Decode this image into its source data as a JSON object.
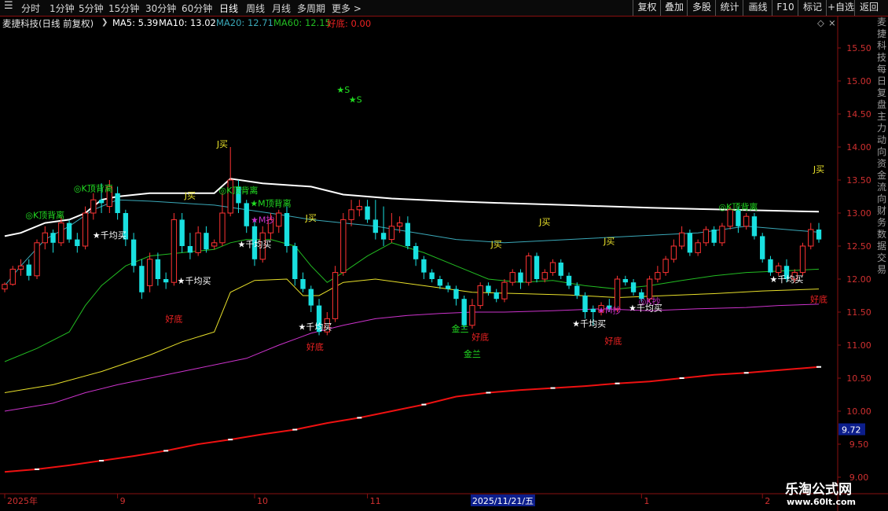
{
  "topbar": {
    "periods": [
      "分时",
      "1分钟",
      "5分钟",
      "15分钟",
      "30分钟",
      "60分钟",
      "日线",
      "周线",
      "月线",
      "多周期",
      "更多 >"
    ],
    "active_period": "日线",
    "buttons": [
      "复权",
      "叠加",
      "多股",
      "统计",
      "画线",
      "F10",
      "标记",
      "+自选",
      "返回"
    ]
  },
  "infobar": {
    "stock": "麦捷科技(日线 前复权)",
    "ma5": "MA5: 5.39",
    "ma10": "MA10: 13.02",
    "ma20": "MA20: 12.71",
    "ma60": "MA60: 12.15",
    "haodi": "好底: 0.00"
  },
  "colors": {
    "up": "#ff3333",
    "down": "#19e0e0",
    "ma10": "#ffffff",
    "ma20": "#3aa8b8",
    "ma60": "#22bb22",
    "ma_yellow": "#e8e02a",
    "ma_magenta": "#cc33cc",
    "long_line": "#ee1111",
    "axis": "#8a1010",
    "green_label": "#22dd22",
    "red_label": "#ee2222",
    "yellow_label": "#e8e02a",
    "white_label": "#ffffff"
  },
  "axis": {
    "y_ticks": [
      "15.50",
      "15.00",
      "14.50",
      "14.00",
      "13.50",
      "13.00",
      "12.50",
      "12.00",
      "11.50",
      "11.00",
      "10.50",
      "10.00",
      "9.50",
      "9.00"
    ],
    "price_tag": "9.72",
    "x_labels": [
      {
        "text": "2025年",
        "day": 0
      },
      {
        "text": "9",
        "day": 14
      },
      {
        "text": "10",
        "day": 31
      },
      {
        "text": "11",
        "day": 45
      },
      {
        "text": "2025/11/21/五",
        "day": 58
      },
      {
        "text": "1",
        "day": 79
      },
      {
        "text": "2",
        "day": 94
      }
    ]
  },
  "side_text": "麦捷科技每日复盘主力动向资金流向财务数据交易",
  "chart_data": {
    "type": "candlestick",
    "y_range": [
      8.75,
      15.75
    ],
    "days": 102,
    "candles": [
      [
        11.85,
        11.92,
        11.8,
        11.95
      ],
      [
        11.92,
        12.15,
        11.9,
        12.2
      ],
      [
        12.15,
        12.2,
        12.05,
        12.3
      ],
      [
        12.22,
        12.05,
        11.98,
        12.3
      ],
      [
        12.05,
        12.55,
        12.0,
        12.6
      ],
      [
        12.55,
        12.7,
        12.45,
        12.8
      ],
      [
        12.7,
        12.55,
        12.4,
        12.75
      ],
      [
        12.55,
        12.85,
        12.5,
        12.95
      ],
      [
        12.85,
        12.6,
        12.55,
        12.9
      ],
      [
        12.6,
        12.5,
        12.4,
        12.7
      ],
      [
        12.5,
        13.0,
        12.45,
        13.1
      ],
      [
        13.0,
        13.2,
        12.9,
        13.3
      ],
      [
        13.2,
        13.15,
        13.0,
        13.45
      ],
      [
        13.1,
        13.4,
        13.0,
        13.5
      ],
      [
        13.3,
        13.0,
        12.9,
        13.4
      ],
      [
        13.0,
        12.6,
        12.5,
        13.05
      ],
      [
        12.6,
        12.2,
        12.1,
        12.7
      ],
      [
        12.2,
        11.8,
        11.7,
        12.3
      ],
      [
        11.9,
        12.3,
        11.8,
        12.4
      ],
      [
        12.3,
        12.0,
        11.9,
        12.4
      ],
      [
        12.0,
        11.95,
        11.85,
        12.1
      ],
      [
        11.95,
        12.9,
        11.9,
        13.0
      ],
      [
        12.9,
        12.5,
        12.4,
        13.0
      ],
      [
        12.5,
        12.4,
        12.3,
        12.7
      ],
      [
        12.4,
        12.7,
        12.35,
        12.8
      ],
      [
        12.7,
        12.45,
        12.4,
        12.8
      ],
      [
        12.5,
        12.55,
        12.45,
        12.6
      ],
      [
        12.55,
        13.0,
        12.5,
        13.3
      ],
      [
        13.0,
        13.5,
        12.95,
        14.0
      ],
      [
        13.4,
        13.15,
        13.0,
        13.5
      ],
      [
        13.15,
        12.8,
        12.7,
        13.2
      ],
      [
        12.8,
        12.3,
        12.2,
        12.9
      ],
      [
        12.3,
        12.7,
        12.25,
        12.8
      ],
      [
        12.7,
        12.9,
        12.6,
        13.0
      ],
      [
        12.8,
        13.0,
        12.7,
        13.05
      ],
      [
        13.0,
        12.5,
        12.4,
        13.1
      ],
      [
        12.5,
        12.0,
        11.9,
        12.55
      ],
      [
        12.0,
        11.85,
        11.8,
        12.1
      ],
      [
        11.85,
        11.6,
        11.5,
        11.9
      ],
      [
        11.6,
        11.2,
        11.15,
        11.7
      ],
      [
        11.2,
        11.4,
        11.15,
        11.5
      ],
      [
        11.4,
        12.1,
        11.35,
        12.2
      ],
      [
        12.1,
        12.9,
        12.05,
        13.0
      ],
      [
        12.9,
        13.05,
        12.8,
        13.2
      ],
      [
        13.05,
        13.1,
        12.95,
        13.2
      ],
      [
        13.1,
        12.9,
        12.85,
        13.2
      ],
      [
        12.9,
        12.7,
        12.6,
        13.2
      ],
      [
        12.7,
        12.6,
        12.5,
        13.1
      ],
      [
        12.6,
        12.8,
        12.55,
        13.0
      ],
      [
        12.8,
        12.85,
        12.7,
        12.95
      ],
      [
        12.85,
        12.5,
        12.45,
        12.95
      ],
      [
        12.5,
        12.3,
        12.2,
        12.55
      ],
      [
        12.3,
        12.1,
        12.0,
        12.35
      ],
      [
        12.1,
        12.0,
        11.95,
        12.15
      ],
      [
        12.0,
        11.9,
        11.85,
        12.05
      ],
      [
        11.9,
        11.85,
        11.8,
        11.95
      ],
      [
        11.85,
        11.7,
        11.6,
        11.9
      ],
      [
        11.7,
        11.3,
        11.25,
        11.75
      ],
      [
        11.3,
        11.6,
        11.25,
        11.7
      ],
      [
        11.6,
        11.9,
        11.55,
        11.95
      ],
      [
        11.9,
        11.8,
        11.75,
        11.95
      ],
      [
        11.8,
        11.7,
        11.65,
        11.85
      ],
      [
        11.7,
        11.95,
        11.65,
        12.0
      ],
      [
        11.95,
        12.1,
        11.9,
        12.15
      ],
      [
        12.1,
        11.95,
        11.85,
        12.15
      ],
      [
        11.95,
        12.35,
        11.9,
        12.4
      ],
      [
        12.35,
        12.0,
        11.95,
        12.4
      ],
      [
        12.0,
        12.1,
        11.95,
        12.15
      ],
      [
        12.1,
        12.25,
        12.05,
        12.3
      ],
      [
        12.25,
        12.05,
        12.0,
        12.3
      ],
      [
        12.05,
        11.9,
        11.85,
        12.1
      ],
      [
        11.9,
        11.75,
        11.7,
        11.95
      ],
      [
        11.75,
        11.5,
        11.4,
        11.8
      ],
      [
        11.55,
        11.5,
        11.3,
        11.6
      ],
      [
        11.5,
        11.6,
        11.45,
        11.65
      ],
      [
        11.6,
        11.55,
        11.5,
        11.7
      ],
      [
        11.55,
        12.0,
        11.5,
        12.05
      ],
      [
        12.0,
        11.95,
        11.9,
        12.05
      ],
      [
        11.95,
        11.8,
        11.75,
        12.0
      ],
      [
        11.8,
        11.7,
        11.65,
        11.85
      ],
      [
        11.7,
        12.0,
        11.65,
        12.05
      ],
      [
        12.0,
        12.1,
        11.95,
        12.2
      ],
      [
        12.1,
        12.3,
        12.05,
        12.35
      ],
      [
        12.3,
        12.5,
        12.25,
        12.6
      ],
      [
        12.5,
        12.7,
        12.45,
        12.8
      ],
      [
        12.7,
        12.4,
        12.35,
        12.75
      ],
      [
        12.4,
        12.55,
        12.35,
        12.6
      ],
      [
        12.55,
        12.75,
        12.5,
        12.8
      ],
      [
        12.75,
        12.55,
        12.5,
        12.8
      ],
      [
        12.55,
        12.8,
        12.5,
        12.85
      ],
      [
        12.8,
        13.05,
        12.75,
        13.1
      ],
      [
        13.05,
        12.8,
        12.7,
        13.1
      ],
      [
        12.8,
        12.95,
        12.75,
        13.0
      ],
      [
        12.95,
        12.65,
        12.6,
        13.0
      ],
      [
        12.65,
        12.3,
        12.25,
        12.7
      ],
      [
        12.3,
        12.1,
        12.05,
        12.35
      ],
      [
        12.1,
        12.2,
        12.05,
        12.25
      ],
      [
        12.2,
        12.0,
        11.95,
        12.3
      ],
      [
        12.0,
        12.1,
        11.95,
        12.15
      ],
      [
        12.1,
        12.5,
        12.05,
        12.55
      ],
      [
        12.5,
        12.75,
        12.45,
        12.85
      ],
      [
        12.75,
        12.6,
        12.55,
        12.85
      ]
    ],
    "ma_white": [
      [
        0,
        12.65
      ],
      [
        2,
        12.7
      ],
      [
        5,
        12.85
      ],
      [
        8,
        12.9
      ],
      [
        10,
        13.0
      ],
      [
        12,
        13.2
      ],
      [
        14,
        13.25
      ],
      [
        18,
        13.3
      ],
      [
        22,
        13.3
      ],
      [
        26,
        13.3
      ],
      [
        28,
        13.52
      ],
      [
        32,
        13.45
      ],
      [
        38,
        13.4
      ],
      [
        42,
        13.28
      ],
      [
        48,
        13.22
      ],
      [
        55,
        13.18
      ],
      [
        62,
        13.15
      ],
      [
        70,
        13.12
      ],
      [
        80,
        13.08
      ],
      [
        90,
        13.05
      ],
      [
        101,
        13.02
      ]
    ],
    "ma_cyan": [
      [
        0,
        11.9
      ],
      [
        2,
        12.2
      ],
      [
        5,
        12.6
      ],
      [
        8,
        12.8
      ],
      [
        11,
        13.05
      ],
      [
        14,
        13.2
      ],
      [
        18,
        13.18
      ],
      [
        22,
        13.15
      ],
      [
        26,
        13.12
      ],
      [
        30,
        13.05
      ],
      [
        34,
        12.98
      ],
      [
        38,
        12.9
      ],
      [
        42,
        12.85
      ],
      [
        46,
        12.8
      ],
      [
        50,
        12.72
      ],
      [
        56,
        12.6
      ],
      [
        62,
        12.55
      ],
      [
        70,
        12.6
      ],
      [
        78,
        12.65
      ],
      [
        86,
        12.7
      ],
      [
        92,
        12.8
      ],
      [
        97,
        12.75
      ],
      [
        101,
        12.71
      ]
    ],
    "ma_green": [
      [
        0,
        10.75
      ],
      [
        4,
        10.95
      ],
      [
        8,
        11.2
      ],
      [
        10,
        11.6
      ],
      [
        12,
        11.9
      ],
      [
        15,
        12.2
      ],
      [
        18,
        12.35
      ],
      [
        22,
        12.4
      ],
      [
        26,
        12.45
      ],
      [
        28,
        12.55
      ],
      [
        30,
        12.6
      ],
      [
        33,
        12.6
      ],
      [
        36,
        12.5
      ],
      [
        38,
        12.2
      ],
      [
        40,
        11.95
      ],
      [
        42,
        12.1
      ],
      [
        45,
        12.35
      ],
      [
        48,
        12.55
      ],
      [
        52,
        12.4
      ],
      [
        56,
        12.2
      ],
      [
        60,
        12.0
      ],
      [
        64,
        11.95
      ],
      [
        68,
        11.98
      ],
      [
        72,
        11.9
      ],
      [
        76,
        11.85
      ],
      [
        80,
        11.9
      ],
      [
        84,
        11.98
      ],
      [
        88,
        12.05
      ],
      [
        92,
        12.1
      ],
      [
        96,
        12.12
      ],
      [
        101,
        12.15
      ]
    ],
    "ma_yellow": [
      [
        0,
        10.28
      ],
      [
        6,
        10.4
      ],
      [
        12,
        10.6
      ],
      [
        18,
        10.85
      ],
      [
        22,
        11.05
      ],
      [
        26,
        11.2
      ],
      [
        28,
        11.8
      ],
      [
        31,
        11.98
      ],
      [
        35,
        12.0
      ],
      [
        37,
        11.75
      ],
      [
        39,
        11.75
      ],
      [
        42,
        11.95
      ],
      [
        46,
        12.0
      ],
      [
        52,
        11.9
      ],
      [
        58,
        11.8
      ],
      [
        64,
        11.78
      ],
      [
        70,
        11.76
      ],
      [
        76,
        11.72
      ],
      [
        82,
        11.75
      ],
      [
        88,
        11.78
      ],
      [
        94,
        11.82
      ],
      [
        101,
        11.85
      ]
    ],
    "ma_magenta": [
      [
        0,
        10.0
      ],
      [
        6,
        10.12
      ],
      [
        10,
        10.28
      ],
      [
        14,
        10.4
      ],
      [
        18,
        10.5
      ],
      [
        24,
        10.65
      ],
      [
        30,
        10.8
      ],
      [
        34,
        11.0
      ],
      [
        38,
        11.18
      ],
      [
        42,
        11.3
      ],
      [
        46,
        11.4
      ],
      [
        50,
        11.45
      ],
      [
        54,
        11.48
      ],
      [
        58,
        11.5
      ],
      [
        62,
        11.5
      ],
      [
        68,
        11.52
      ],
      [
        74,
        11.55
      ],
      [
        80,
        11.52
      ],
      [
        86,
        11.55
      ],
      [
        92,
        11.57
      ],
      [
        96,
        11.6
      ],
      [
        101,
        11.62
      ]
    ],
    "long_red": [
      [
        0,
        9.08
      ],
      [
        4,
        9.12
      ],
      [
        8,
        9.18
      ],
      [
        12,
        9.25
      ],
      [
        16,
        9.32
      ],
      [
        20,
        9.4
      ],
      [
        24,
        9.5
      ],
      [
        28,
        9.57
      ],
      [
        32,
        9.65
      ],
      [
        36,
        9.72
      ],
      [
        40,
        9.82
      ],
      [
        44,
        9.9
      ],
      [
        48,
        10.0
      ],
      [
        52,
        10.1
      ],
      [
        56,
        10.22
      ],
      [
        60,
        10.28
      ],
      [
        64,
        10.32
      ],
      [
        68,
        10.35
      ],
      [
        72,
        10.38
      ],
      [
        76,
        10.42
      ],
      [
        80,
        10.45
      ],
      [
        84,
        10.5
      ],
      [
        88,
        10.55
      ],
      [
        92,
        10.58
      ],
      [
        96,
        10.62
      ],
      [
        101,
        10.67
      ]
    ],
    "annotations": [
      {
        "text": "★S",
        "day": 42,
        "price": 14.82,
        "color": "#22dd22"
      },
      {
        "text": "★S",
        "day": 43.5,
        "price": 14.67,
        "color": "#22dd22"
      },
      {
        "text": "J买",
        "day": 27,
        "price": 14.0,
        "color": "#e8e02a"
      },
      {
        "text": "J买",
        "day": 23,
        "price": 13.22,
        "color": "#e8e02a"
      },
      {
        "text": "J买",
        "day": 38,
        "price": 12.88,
        "color": "#e8e02a"
      },
      {
        "text": "J买",
        "day": 61,
        "price": 12.48,
        "color": "#e8e02a"
      },
      {
        "text": "J买",
        "day": 67,
        "price": 12.82,
        "color": "#e8e02a"
      },
      {
        "text": "J买",
        "day": 75,
        "price": 12.53,
        "color": "#e8e02a"
      },
      {
        "text": "J买",
        "day": 101,
        "price": 13.62,
        "color": "#e8e02a"
      },
      {
        "text": "◎K顶背离",
        "day": 11,
        "price": 13.33,
        "color": "#22dd22"
      },
      {
        "text": "◎K顶背离",
        "day": 5,
        "price": 12.92,
        "color": "#22dd22"
      },
      {
        "text": "◎K顶背离",
        "day": 29,
        "price": 13.3,
        "color": "#22dd22"
      },
      {
        "text": "★M顶背离",
        "day": 33,
        "price": 13.1,
        "color": "#22dd22"
      },
      {
        "text": "◎K顶背离",
        "day": 91,
        "price": 13.05,
        "color": "#22dd22"
      },
      {
        "text": "★M抄",
        "day": 32,
        "price": 12.85,
        "color": "#cc33cc"
      },
      {
        "text": "★M抄",
        "day": 75,
        "price": 11.48,
        "color": "#cc33cc"
      },
      {
        "text": "◎K抄",
        "day": 80,
        "price": 11.62,
        "color": "#cc33cc"
      },
      {
        "text": "★千均买",
        "day": 13,
        "price": 12.62,
        "color": "#ffffff"
      },
      {
        "text": "★千均买",
        "day": 31,
        "price": 12.48,
        "color": "#ffffff"
      },
      {
        "text": "★千均买",
        "day": 23.5,
        "price": 11.93,
        "color": "#ffffff"
      },
      {
        "text": "★千均买",
        "day": 38.5,
        "price": 11.23,
        "color": "#ffffff"
      },
      {
        "text": "★千均买",
        "day": 72.5,
        "price": 11.28,
        "color": "#ffffff"
      },
      {
        "text": "★千均买",
        "day": 79.5,
        "price": 11.52,
        "color": "#ffffff"
      },
      {
        "text": "★千均买",
        "day": 97,
        "price": 11.95,
        "color": "#ffffff"
      },
      {
        "text": "好底",
        "day": 21,
        "price": 11.35,
        "color": "#ee2222"
      },
      {
        "text": "好底",
        "day": 38.5,
        "price": 10.93,
        "color": "#ee2222"
      },
      {
        "text": "好底",
        "day": 59,
        "price": 11.08,
        "color": "#ee2222"
      },
      {
        "text": "好底",
        "day": 75.5,
        "price": 11.02,
        "color": "#ee2222"
      },
      {
        "text": "好底",
        "day": 101,
        "price": 11.65,
        "color": "#ee2222"
      },
      {
        "text": "金兰",
        "day": 56.5,
        "price": 11.2,
        "color": "#22dd22"
      },
      {
        "text": "金兰",
        "day": 58,
        "price": 10.82,
        "color": "#22dd22"
      }
    ]
  }
}
